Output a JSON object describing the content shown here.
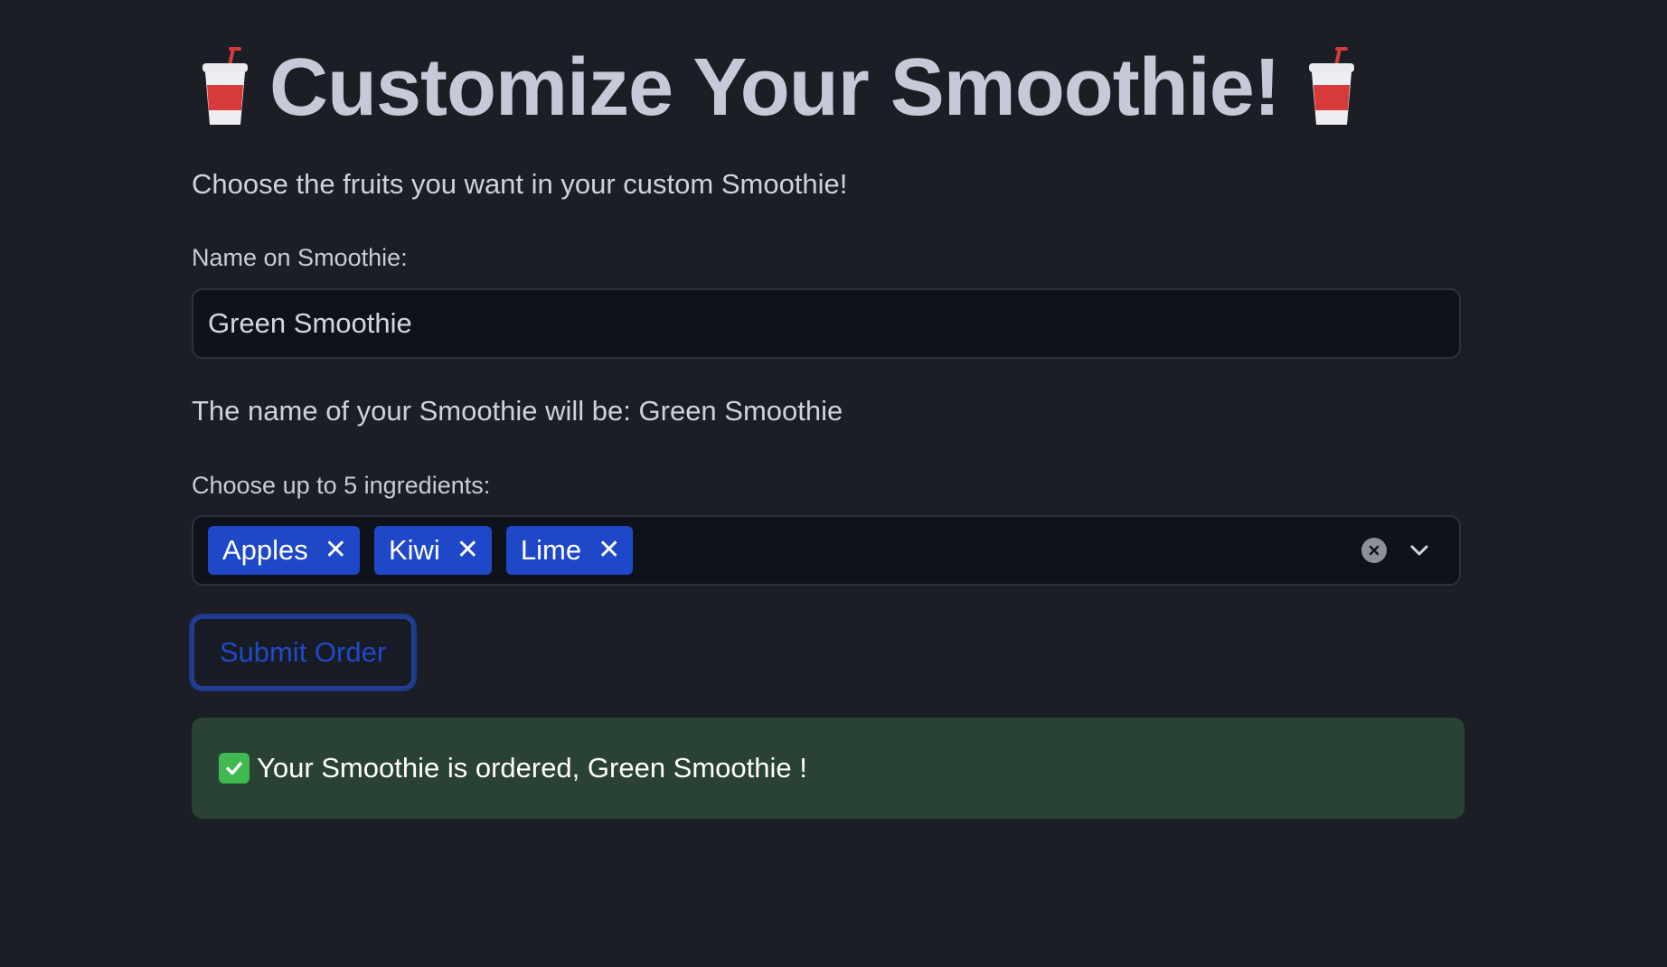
{
  "header": {
    "title": "Customize Your Smoothie!",
    "left_icon": "cup-with-straw-icon",
    "right_icon": "cup-with-straw-icon"
  },
  "subtitle": "Choose the fruits you want in your custom Smoothie!",
  "name_field": {
    "label": "Name on Smoothie:",
    "value": "Green Smoothie"
  },
  "name_preview": "The name of your Smoothie will be: Green Smoothie",
  "ingredients": {
    "label": "Choose up to 5 ingredients:",
    "selected": [
      {
        "label": "Apples"
      },
      {
        "label": "Kiwi"
      },
      {
        "label": "Lime"
      }
    ],
    "remove_glyph": "✕"
  },
  "submit_label": "Submit Order",
  "success_message": "Your Smoothie is ordered, Green Smoothie !",
  "colors": {
    "background": "#1b1e24",
    "chip": "#1f48c8",
    "success_bg": "#2a4233",
    "button_text": "#2149c8"
  }
}
